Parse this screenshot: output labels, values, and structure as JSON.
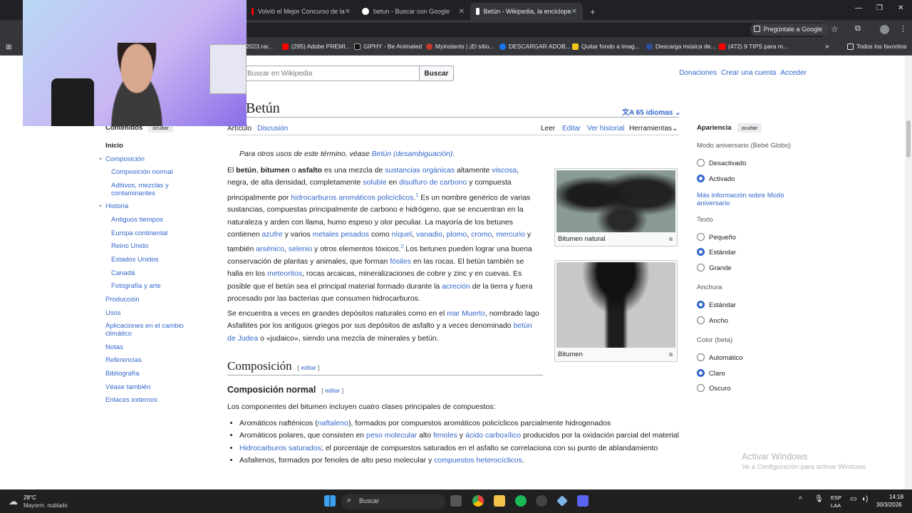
{
  "browser": {
    "tabs": [
      {
        "label": "Volvió el Mejor Concurso de la"
      },
      {
        "label": "betun - Buscar con Google"
      },
      {
        "label": "Betún - Wikipedia, la enciclope"
      }
    ],
    "ask_google": "Pregúntale a Google",
    "bookmarks": [
      "2023.rar...",
      "(295) Adobe PREMI...",
      "GIPHY - Be Animated",
      "Myinstants | ¡El sitio...",
      "DESCARGAR ADOB...",
      "Quitar fondo a imag...",
      "Descarga música de...",
      "(472) 9 TIPS para m..."
    ],
    "all_bookmarks": "Todos los favoritos"
  },
  "wiki": {
    "search_placeholder": "Buscar en Wikipedia",
    "search_button": "Buscar",
    "top_links": [
      "Donaciones",
      "Crear una cuenta",
      "Acceder"
    ],
    "title": "Betún",
    "languages": "65 idiomas",
    "tabs_left": [
      "Artículo",
      "Discusión"
    ],
    "tabs_right": [
      "Leer",
      "Editar",
      "Ver historial",
      "Herramientas"
    ],
    "toc_title": "Contenidos",
    "toc_hide": "ocultar",
    "toc": [
      "Inicio",
      "Composición",
      "Composición normal",
      "Aditivos, mezclas y",
      "contaminantes",
      "Historia",
      "Antiguos tiempos",
      "Europa continental",
      "Reino Unido",
      "Estados Unidos",
      "Canadá",
      "Fotografía y arte",
      "Producción",
      "Usos",
      "Aplicaciones en el cambio",
      "climático",
      "Notas",
      "Referencias",
      "Bibliografía",
      "Véase también",
      "Enlaces externos"
    ],
    "hatnote_prefix": "Para otros usos de este término, véase ",
    "hatnote_link": "Betún (desambiguación)",
    "caption1": "Bitumen natural",
    "caption2": "Bitumen",
    "h2": "Composición",
    "h3": "Composición normal",
    "edit": "editar",
    "list_intro": "Los componentes del bitumen incluyen cuatro clases principales de compuestos:",
    "appearance": {
      "title": "Apariencia",
      "hide": "ocultar",
      "anniv_label": "Modo aniversario (Bebé Globo)",
      "opt_off": "Desactivado",
      "opt_on": "Activado",
      "more": "Más información sobre Modo",
      "more2": "aniversario",
      "text_label": "Texto",
      "small": "Pequeño",
      "standard": "Estándar",
      "large": "Grande",
      "width_label": "Anchura",
      "w_standard": "Estándar",
      "w_wide": "Ancho",
      "color_label": "Color (beta)",
      "c_auto": "Automático",
      "c_light": "Claro",
      "c_dark": "Oscuro"
    }
  },
  "windows": {
    "activate_title": "Activar Windows",
    "activate_sub": "Ve a Configuración para activar Windows.",
    "weather_temp": "28°C",
    "weather_desc": "Mayorm. nublado",
    "search": "Buscar",
    "lang1": "ESP",
    "lang2": "LAA",
    "time": "14:18",
    "date": "30/3/2026"
  }
}
